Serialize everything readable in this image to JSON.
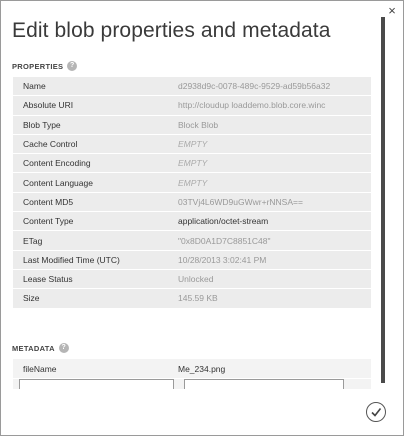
{
  "dialog": {
    "title": "Edit blob properties and metadata",
    "close_glyph": "×",
    "close_icon": "close-icon",
    "confirm_icon": "checkmark-icon"
  },
  "properties": {
    "heading": "PROPERTIES",
    "help_glyph": "?",
    "rows": [
      {
        "key": "Name",
        "value": "d2938d9c-0078-489c-9529-ad59b56a32"
      },
      {
        "key": "Absolute URI",
        "value": "http://cloudup loaddemo.blob.core.winc"
      },
      {
        "key": "Blob Type",
        "value": "Block Blob"
      },
      {
        "key": "Cache Control",
        "value": "EMPTY"
      },
      {
        "key": "Content Encoding",
        "value": "EMPTY"
      },
      {
        "key": "Content Language",
        "value": "EMPTY"
      },
      {
        "key": "Content MD5",
        "value": "03TVj4L6WD9uGWwr+rNNSA=="
      },
      {
        "key": "Content Type",
        "value": "application/octet-stream"
      },
      {
        "key": "ETag",
        "value": "\"0x8D0A1D7C8851C48\""
      },
      {
        "key": "Last Modified Time (UTC)",
        "value": "10/28/2013 3:02:41 PM"
      },
      {
        "key": "Lease Status",
        "value": "Unlocked"
      },
      {
        "key": "Size",
        "value": "145.59 KB"
      }
    ]
  },
  "metadata": {
    "heading": "METADATA",
    "help_glyph": "?",
    "rows": [
      {
        "key": "fileName",
        "value": "Me_234.png"
      }
    ],
    "new_key_value": "",
    "new_value_value": ""
  },
  "colors": {
    "row_alt": "#ececec",
    "scrollbar": "#4a4a4a"
  }
}
